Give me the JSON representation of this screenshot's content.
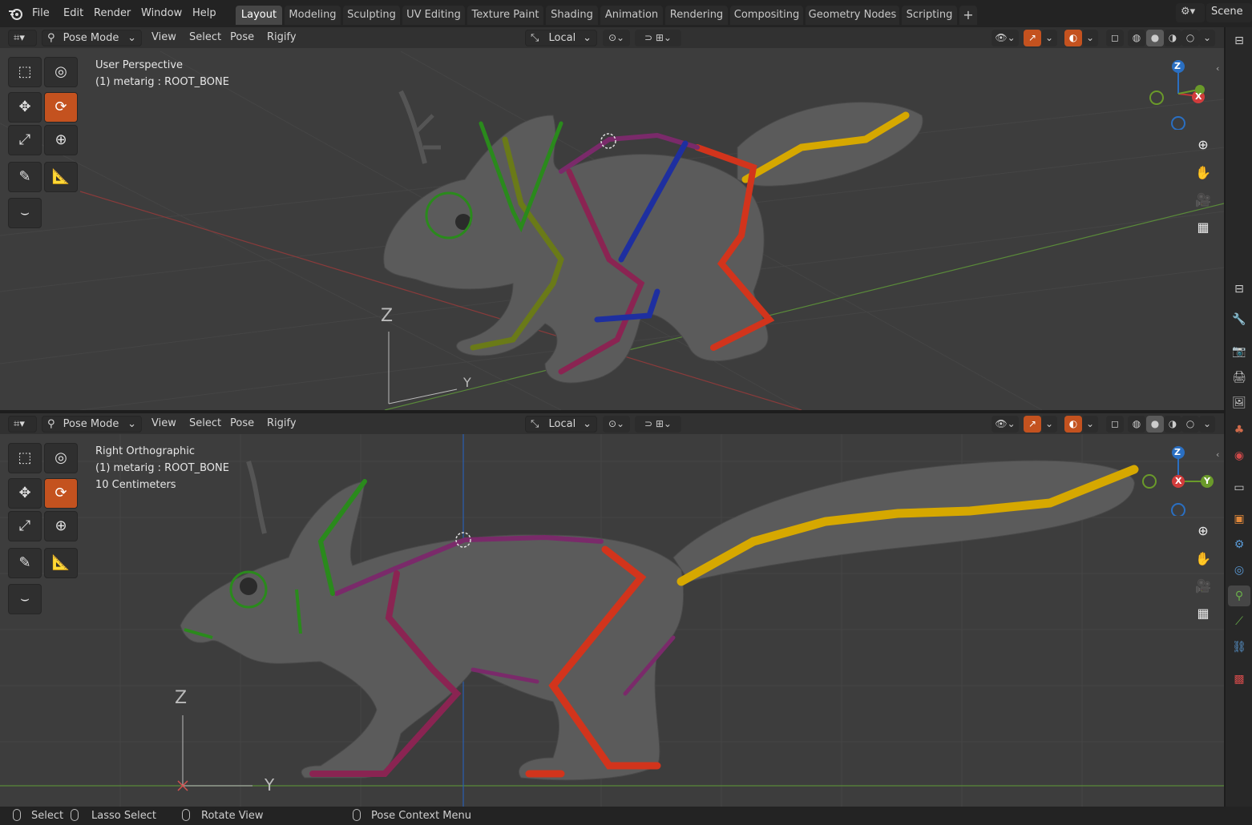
{
  "app": {
    "logo": "blender-logo-icon"
  },
  "menu": [
    "File",
    "Edit",
    "Render",
    "Window",
    "Help"
  ],
  "workspaces": [
    "Layout",
    "Modeling",
    "Sculpting",
    "UV Editing",
    "Texture Paint",
    "Shading",
    "Animation",
    "Rendering",
    "Compositing",
    "Geometry Nodes",
    "Scripting"
  ],
  "active_workspace": "Layout",
  "scene": {
    "label": "Scene"
  },
  "viewport_header": {
    "mode": "Pose Mode",
    "menus": [
      "View",
      "Select",
      "Pose",
      "Rigify"
    ],
    "transform_orientation": "Local"
  },
  "viewport_top": {
    "view_name": "User Perspective",
    "object_info": "(1) metarig : ROOT_BONE"
  },
  "viewport_bottom": {
    "view_name": "Right Orthographic",
    "object_info": "(1) metarig : ROOT_BONE",
    "grid_scale": "10 Centimeters"
  },
  "gizmo": {
    "x": "X",
    "y": "Y",
    "z": "Z"
  },
  "axis_labels": {
    "z": "Z",
    "y": "Y"
  },
  "status_bar": {
    "select": "Select",
    "lasso": "Lasso Select",
    "rotate": "Rotate View",
    "context": "Pose Context Menu"
  },
  "colors": {
    "accent": "#c4521f",
    "viewport_bg": "#3d3d3d",
    "bone_yellow": "#d6a800",
    "bone_red": "#d2341c",
    "bone_green": "#2a8a1c",
    "bone_purple": "#7a2a6a",
    "bone_blue": "#1e2fa0"
  }
}
